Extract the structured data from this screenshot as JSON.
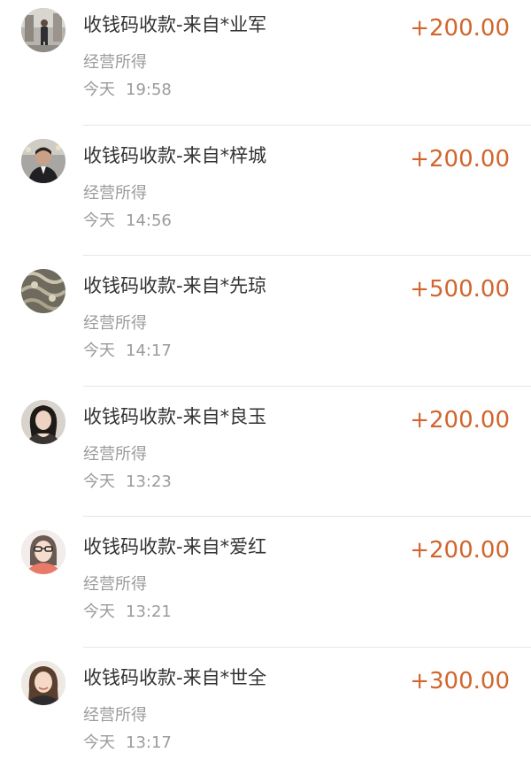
{
  "transactions": [
    {
      "title": "收钱码收款-来自*业军",
      "amount": "+200.00",
      "category": "经营所得",
      "day": "今天",
      "time": "19:58",
      "avatar": "avatar-photo-man-standing"
    },
    {
      "title": "收钱码收款-来自*梓城",
      "amount": "+200.00",
      "category": "经营所得",
      "day": "今天",
      "time": "14:56",
      "avatar": "avatar-photo-man-dark-suit"
    },
    {
      "title": "收钱码收款-来自*先琼",
      "amount": "+500.00",
      "category": "经营所得",
      "day": "今天",
      "time": "14:17",
      "avatar": "avatar-photo-pattern"
    },
    {
      "title": "收钱码收款-来自*良玉",
      "amount": "+200.00",
      "category": "经营所得",
      "day": "今天",
      "time": "13:23",
      "avatar": "avatar-photo-woman-dark-hair"
    },
    {
      "title": "收钱码收款-来自*爱红",
      "amount": "+200.00",
      "category": "经营所得",
      "day": "今天",
      "time": "13:21",
      "avatar": "avatar-photo-woman-glasses"
    },
    {
      "title": "收钱码收款-来自*世全",
      "amount": "+300.00",
      "category": "经营所得",
      "day": "今天",
      "time": "13:17",
      "avatar": "avatar-photo-woman-smiling"
    }
  ],
  "colors": {
    "amount": "#d2652d",
    "title": "#333333",
    "secondary": "#9b9b9b",
    "divider": "#e6e6e6"
  }
}
